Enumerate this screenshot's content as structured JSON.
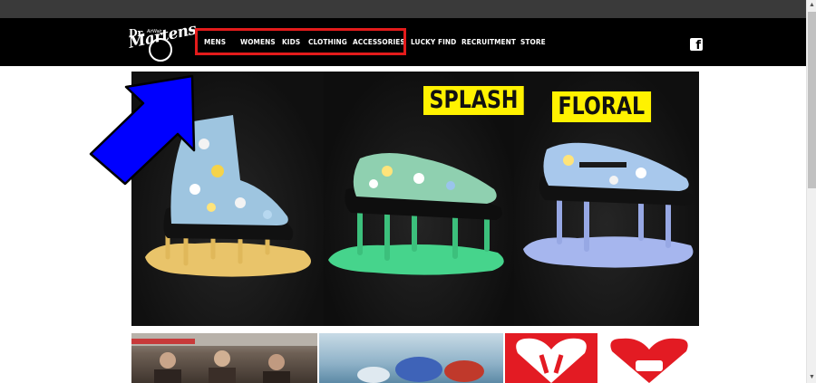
{
  "brand": {
    "logo_dr": "Dr.",
    "logo_airwair": "AirWair",
    "logo_word": "Martens"
  },
  "nav": {
    "items": [
      "MENS",
      "WOMENS",
      "KIDS",
      "CLOTHING",
      "ACCESSORIES",
      "LUCKY FIND",
      "RECRUITMENT",
      "STORE"
    ]
  },
  "social": {
    "facebook_glyph": "f"
  },
  "hero": {
    "tag_splash": "SPLASH",
    "tag_floral": "FLORAL"
  },
  "colors": {
    "nav_bg": "#000000",
    "highlight": "#e31b1b",
    "tag_yellow": "#fff200",
    "arrow_blue": "#0000ff"
  }
}
